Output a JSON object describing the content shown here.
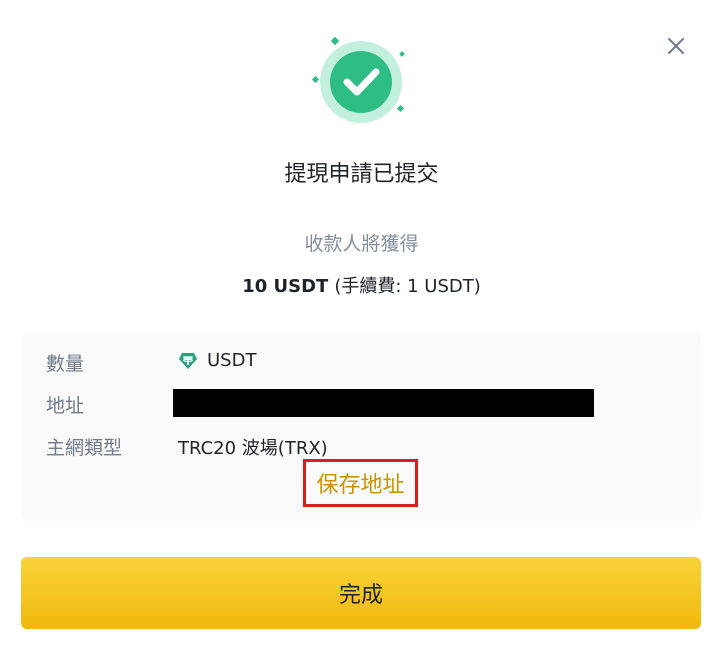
{
  "dialog": {
    "title": "提現申請已提交",
    "recipient_label": "收款人將獲得",
    "amount": "10 USDT",
    "fee": "(手續費: 1 USDT)",
    "close_icon": "close-icon",
    "status_icon": "success-check-icon"
  },
  "info": {
    "quantity_label": "數量",
    "quantity_value": "USDT",
    "quantity_icon": "tether-icon",
    "address_label": "地址",
    "network_label": "主網類型",
    "network_value": "TRC20 波場(TRX)",
    "save_address_label": "保存地址"
  },
  "actions": {
    "done_label": "完成"
  },
  "colors": {
    "accent": "#F0B90B",
    "link": "#C99400",
    "success": "#2EBD85",
    "highlight_border": "#D62020",
    "tether": "#26A17B"
  }
}
